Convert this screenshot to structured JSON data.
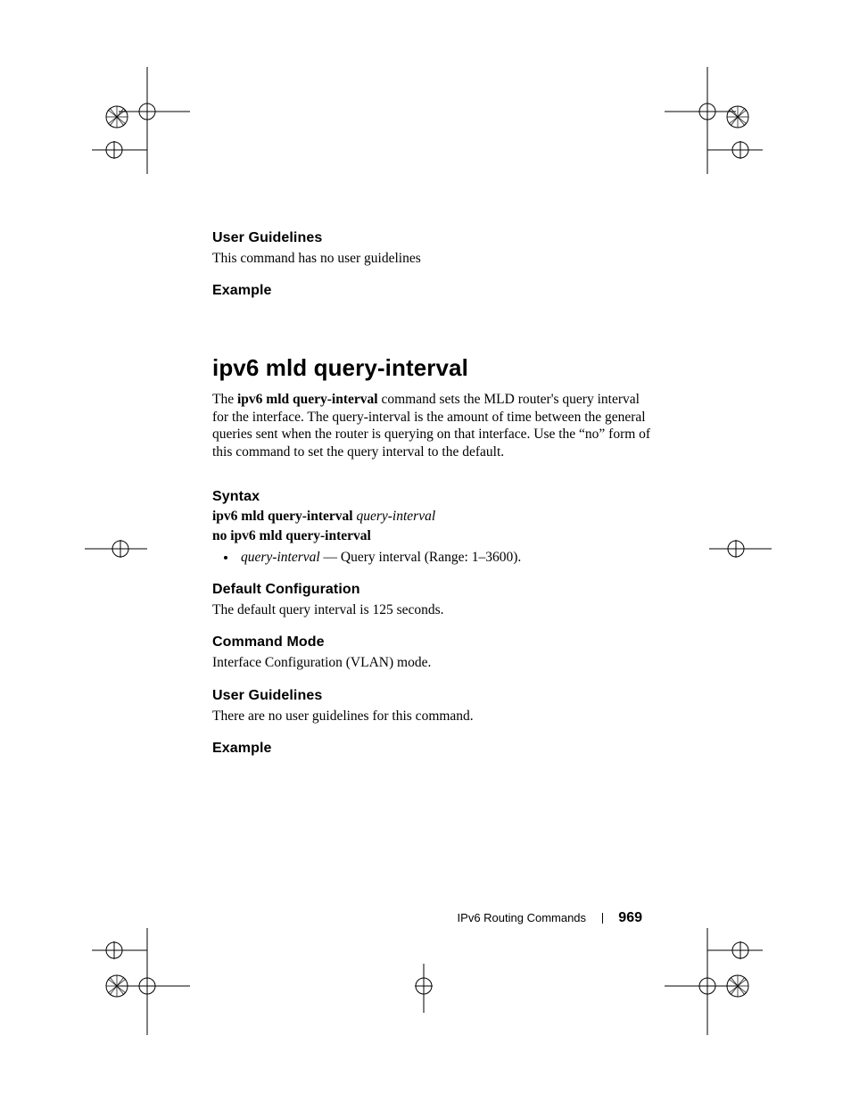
{
  "sections": {
    "ug1_head": "User Guidelines",
    "ug1_body": "This command has no user guidelines",
    "ex1_head": "Example",
    "cmd_title": "ipv6 mld query-interval",
    "cmd_intro_pre": "The ",
    "cmd_intro_bold": "ipv6 mld query-interval",
    "cmd_intro_post": " command sets the MLD router's query interval for the interface. The query-interval is the amount of time between the general queries sent when the router is querying on that interface. Use the “no” form of this command to set the query interval to the default.",
    "syntax_head": "Syntax",
    "syntax_l1_bold": "ipv6 mld query-interval ",
    "syntax_l1_ital": "query-interval",
    "syntax_l2_bold": "no ipv6 mld query-interval",
    "syntax_bullet_ital": "query-interval ",
    "syntax_bullet_rest": "— Query interval (Range: 1–3600).",
    "defcfg_head": "Default Configuration",
    "defcfg_body": "The default query interval is 125 seconds.",
    "cmdmode_head": "Command Mode",
    "cmdmode_body": "Interface Configuration (VLAN) mode.",
    "ug2_head": "User Guidelines",
    "ug2_body": "There are no user guidelines for this command.",
    "ex2_head": "Example"
  },
  "footer": {
    "title": "IPv6 Routing Commands",
    "page": "969"
  }
}
